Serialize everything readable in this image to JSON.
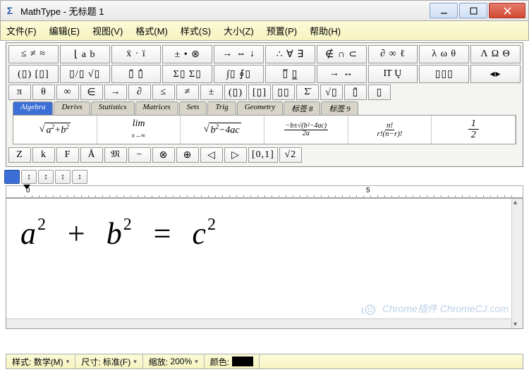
{
  "app_name": "MathType",
  "window_title": "MathType - 无标题 1",
  "menu": [
    "文件(F)",
    "编辑(E)",
    "视图(V)",
    "格式(M)",
    "样式(S)",
    "大小(Z)",
    "预置(P)",
    "帮助(H)"
  ],
  "palette": {
    "row1": [
      "≤ ≠ ≈",
      "⌊ a b",
      "ẍ · ï",
      "± • ⊗",
      "→ ⇔ ↓",
      "∴ ∀ ∃",
      "∉ ∩ ⊂",
      "∂ ∞ ℓ",
      "λ ω θ",
      "Λ Ω Θ"
    ],
    "row2": [
      "(▯) [▯]",
      "▯/▯ √▯",
      "▯̄ ▯̂",
      "Σ▯ Σ▯",
      "∫▯ ∮▯",
      "▯̅ ▯̲",
      "→ ↔",
      "Π̄ Ų",
      "▯▯▯",
      "◂▸"
    ],
    "row3": [
      "π",
      "θ",
      "∞",
      "∈",
      "→",
      "∂",
      "≤",
      "≠",
      "±",
      "(▯)",
      "[▯]",
      "▯▯",
      "Σ̄",
      "√▯",
      "▯̄",
      "▯"
    ]
  },
  "tabs": [
    "Algebra",
    "Derivs",
    "Statistics",
    "Matrices",
    "Sets",
    "Trig",
    "Geometry",
    "标签 8",
    "标签 9"
  ],
  "templates": {
    "algebra": [
      "√(a²+b²)",
      "lim x→∞",
      "√(b²−4ac)",
      "(−b±√(b²−4ac))/2a",
      "n! / r!(n−r)!",
      "1/2"
    ]
  },
  "bottom_row": [
    "Z",
    "k",
    "F",
    "Å",
    "𝔐",
    "−",
    "⊗",
    "⊕",
    "◁",
    "▷",
    "[0,1]",
    "√2"
  ],
  "ruler": {
    "tick0": "0",
    "tick5": "5"
  },
  "equation_display": "a²  +  b²  =  c²",
  "equation": {
    "a": "a",
    "p": "2",
    "plus": "+",
    "b": "b",
    "eq": "=",
    "c": "c"
  },
  "status": {
    "style_label": "样式:",
    "style_value": "数学(M)",
    "size_label": "尺寸:",
    "size_value": "标准(F)",
    "zoom_label": "缩放:",
    "zoom_value": "200%",
    "color_label": "颜色:",
    "color_value": "#000000"
  },
  "watermark": "Chrome插件 ChromeCJ.com"
}
